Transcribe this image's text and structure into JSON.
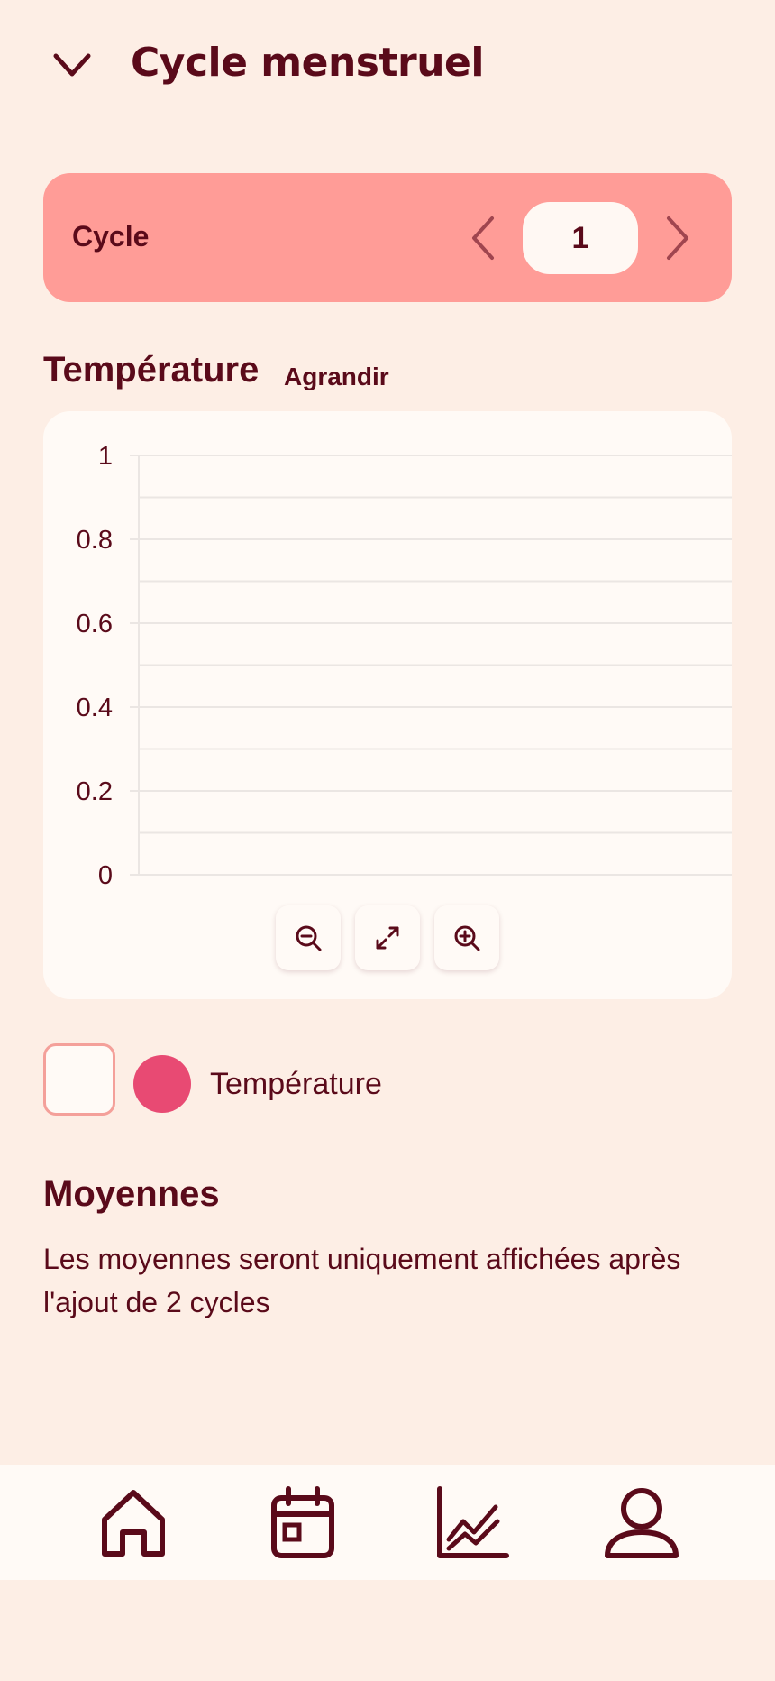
{
  "header": {
    "title": "Cycle menstruel",
    "back_icon": "chevron-down-icon"
  },
  "cycle_selector": {
    "label": "Cycle",
    "value": "1",
    "prev_icon": "chevron-left-icon",
    "next_icon": "chevron-right-icon"
  },
  "temperature": {
    "title": "Température",
    "expand_label": "Agrandir"
  },
  "chart_data": {
    "type": "line",
    "title": "",
    "xlabel": "",
    "ylabel": "",
    "ylim": [
      0,
      1
    ],
    "yticks": [
      "0",
      "0.2",
      "0.4",
      "0.6",
      "0.8",
      "1"
    ],
    "grid": true,
    "series": [
      {
        "name": "Température",
        "values": []
      }
    ]
  },
  "chart_controls": {
    "zoom_out_icon": "zoom-out-icon",
    "reset_icon": "expand-icon",
    "zoom_in_icon": "zoom-in-icon"
  },
  "legend": {
    "label": "Température",
    "color": "#e84a73",
    "checked": false
  },
  "averages": {
    "title": "Moyennes",
    "text": "Les moyennes seront uniquement affichées après l'ajout de 2 cycles"
  },
  "nav": {
    "items": [
      {
        "icon": "home-icon"
      },
      {
        "icon": "calendar-icon"
      },
      {
        "icon": "chart-icon"
      },
      {
        "icon": "profile-icon"
      }
    ]
  },
  "colors": {
    "background": "#fdeee5",
    "accent": "#ff9c97",
    "text": "#5a0a1a",
    "card": "#fffaf6"
  }
}
